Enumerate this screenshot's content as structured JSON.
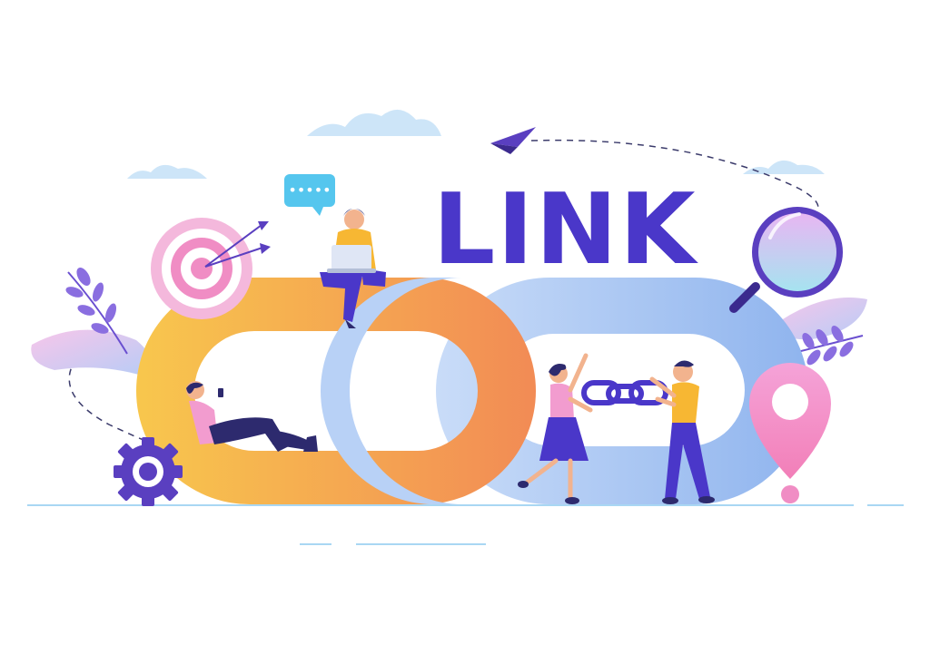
{
  "headline": "LINK",
  "colors": {
    "title": "#4a37c9",
    "orange_link": "#f6a04d",
    "blue_link": "#a9c8f4",
    "pink": "#f29ccf",
    "purple": "#5a3fc0",
    "cloud": "#cde5f8",
    "ground": "#a9d7f3"
  },
  "icons": [
    "target-icon",
    "arrow-icon",
    "chat-bubble-icon",
    "paper-plane-icon",
    "magnifier-icon",
    "location-pin-icon",
    "gear-icon",
    "chain-icon"
  ],
  "chat_bubble": "•••••"
}
